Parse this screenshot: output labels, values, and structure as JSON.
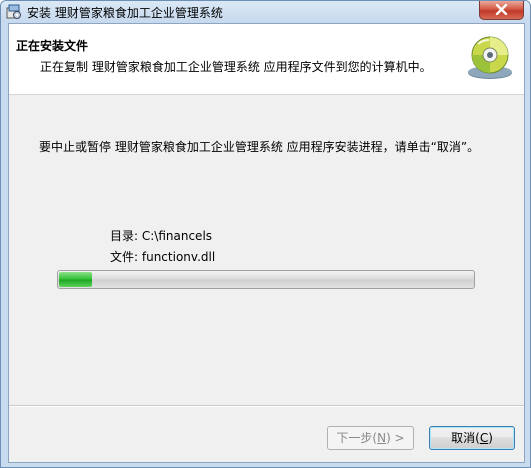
{
  "window": {
    "title": "安装 理财管家粮食加工企业管理系统"
  },
  "header": {
    "title": "正在安装文件",
    "description": "正在复制 理财管家粮食加工企业管理系统 应用程序文件到您的计算机中。"
  },
  "main": {
    "instruction": "要中止或暂停 理财管家粮食加工企业管理系统 应用程序安装进程，请单击“取消”。",
    "directory_label": "目录:",
    "directory_value": "C:\\financels",
    "file_label": "文件:",
    "file_value": "functionv.dll",
    "progress": 0.08
  },
  "buttons": {
    "next_text": "下一步",
    "next_key": "N",
    "cancel_text": "取消",
    "cancel_key": "C"
  },
  "colors": {
    "progress_fill": "#2fbf35",
    "title_bar": "#c6d9ee",
    "close_button": "#c0392b"
  },
  "icons": {
    "title": "installer-icon",
    "header": "cd-disc-icon",
    "close": "close-icon"
  }
}
